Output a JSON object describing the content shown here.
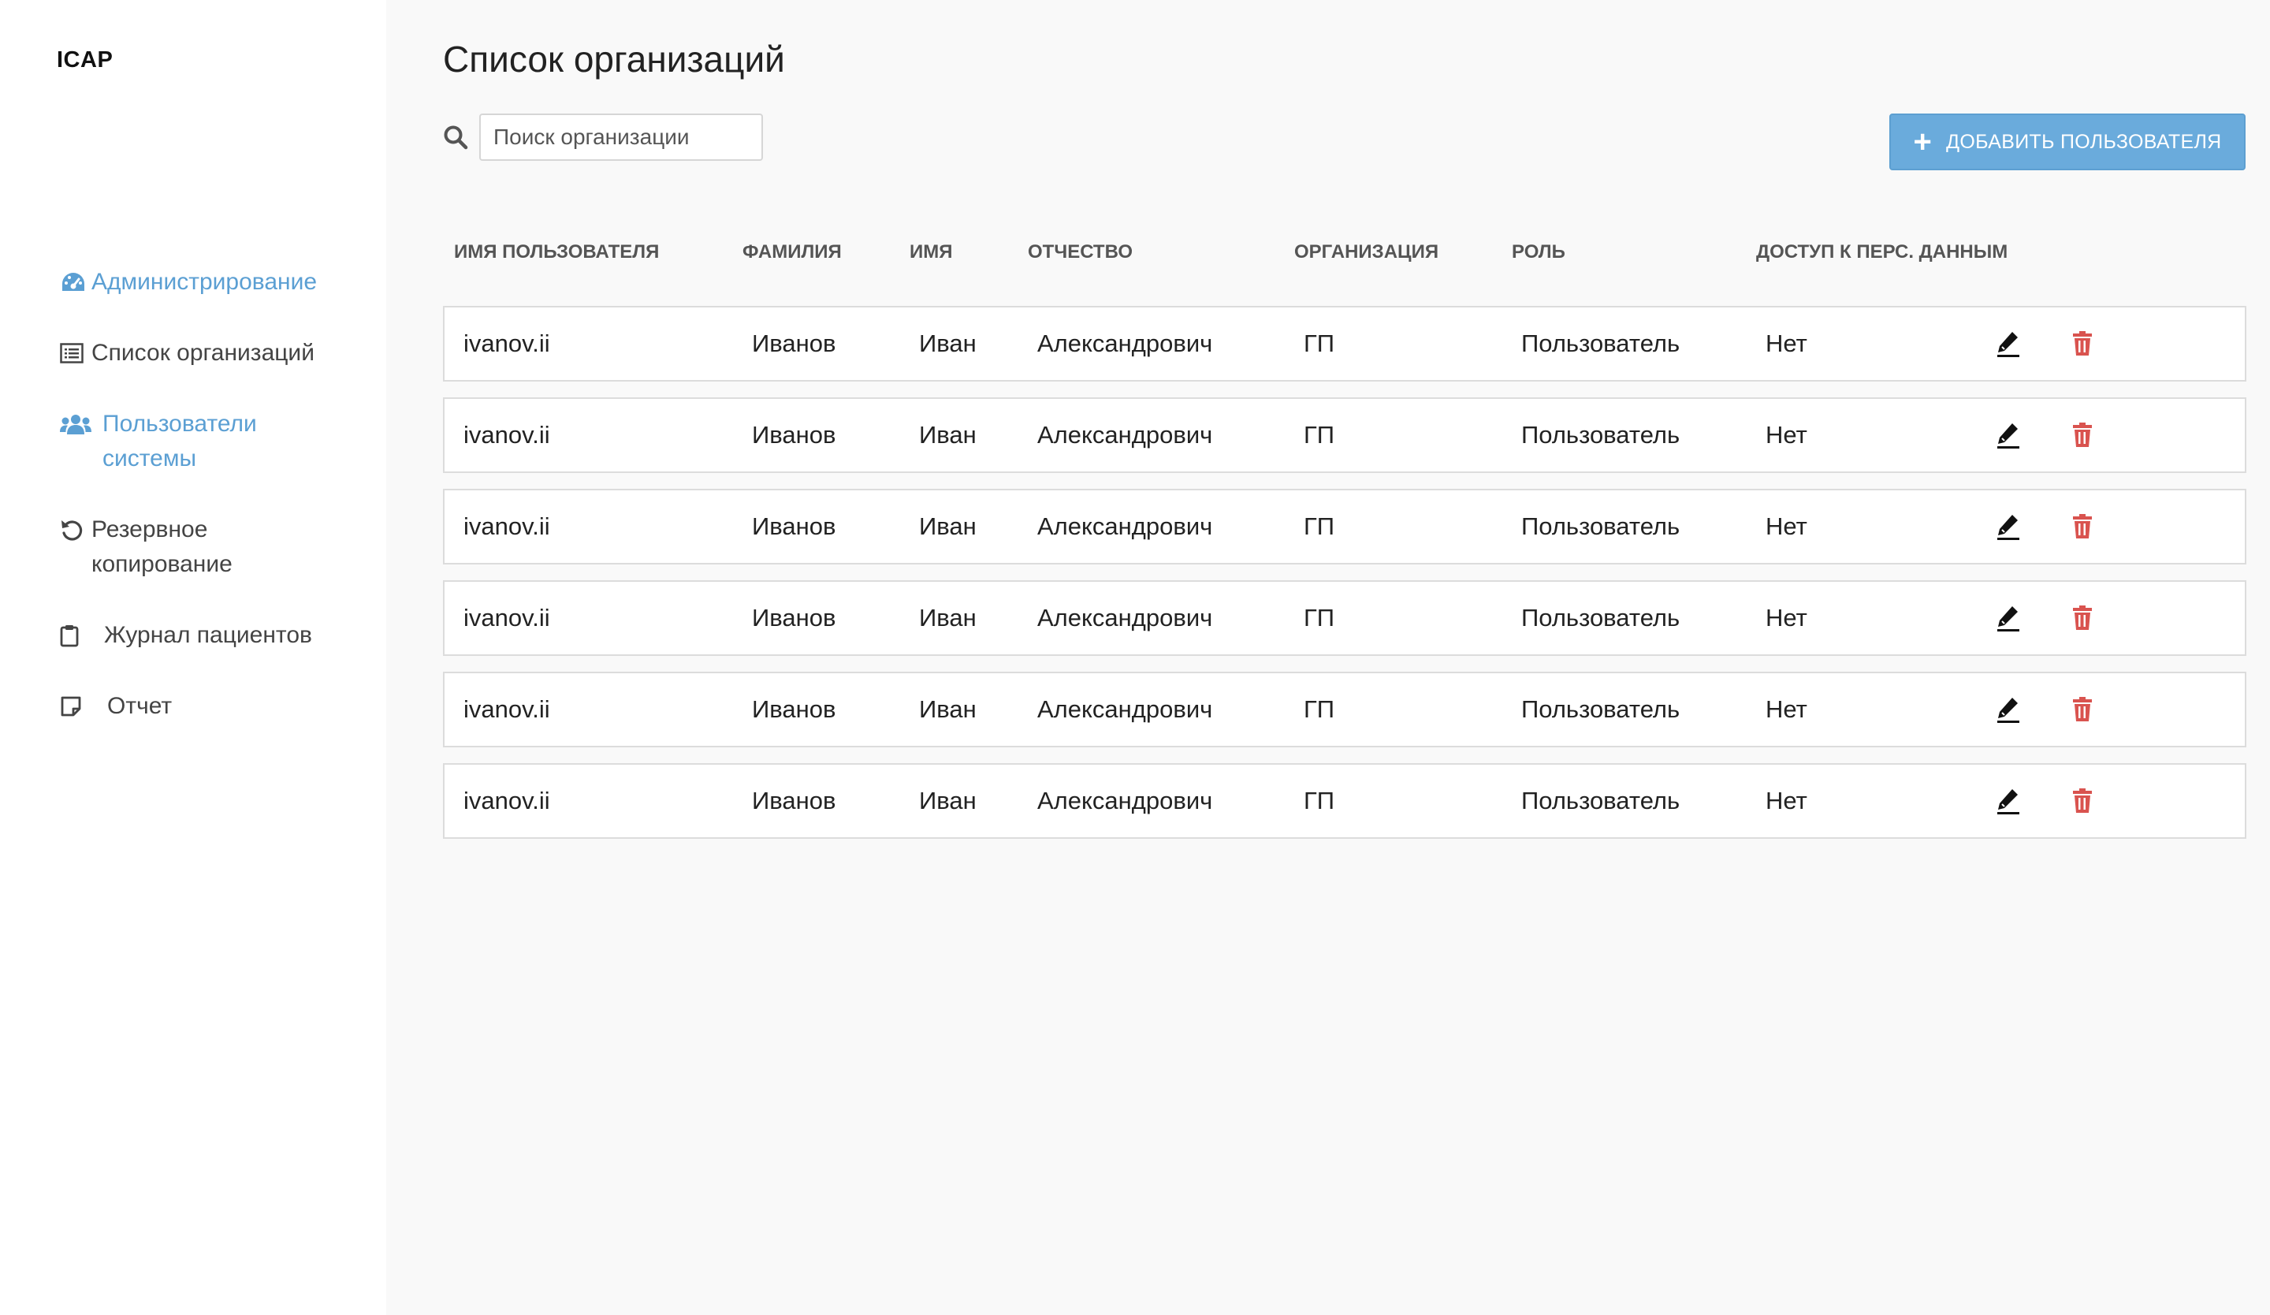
{
  "app": {
    "logo": "ICAP"
  },
  "sidebar": {
    "items": [
      {
        "label": "Администрирование",
        "icon": "dashboard-icon",
        "active": true
      },
      {
        "label": "Список организаций",
        "icon": "list-icon",
        "active": false
      },
      {
        "label": "Пользователи системы",
        "icon": "users-icon",
        "active": true
      },
      {
        "label": "Резервное копирование",
        "icon": "undo-icon",
        "active": false
      },
      {
        "label": "Журнал пациентов",
        "icon": "clipboard-icon",
        "active": false
      },
      {
        "label": "Отчет",
        "icon": "note-icon",
        "active": false
      }
    ]
  },
  "main": {
    "title": "Список организаций",
    "search": {
      "placeholder": "Поиск организации",
      "value": ""
    },
    "add_button": {
      "label": "ДОБАВИТЬ ПОЛЬЗОВАТЕЛЯ",
      "icon": "plus-icon"
    },
    "table": {
      "columns": [
        "Имя пользователя",
        "Фамилия",
        "Имя",
        "Отчество",
        "Организация",
        "Роль",
        "Доступ к перс. данным"
      ],
      "rows": [
        [
          "ivanov.ii",
          "Иванов",
          "Иван",
          "Александрович",
          "ГП",
          "Пользователь",
          "Нет"
        ],
        [
          "ivanov.ii",
          "Иванов",
          "Иван",
          "Александрович",
          "ГП",
          "Пользователь",
          "Нет"
        ],
        [
          "ivanov.ii",
          "Иванов",
          "Иван",
          "Александрович",
          "ГП",
          "Пользователь",
          "Нет"
        ],
        [
          "ivanov.ii",
          "Иванов",
          "Иван",
          "Александрович",
          "ГП",
          "Пользователь",
          "Нет"
        ],
        [
          "ivanov.ii",
          "Иванов",
          "Иван",
          "Александрович",
          "ГП",
          "Пользователь",
          "Нет"
        ],
        [
          "ivanov.ii",
          "Иванов",
          "Иван",
          "Александрович",
          "ГП",
          "Пользователь",
          "Нет"
        ]
      ],
      "row_actions": {
        "edit_icon": "pencil-icon",
        "delete_icon": "trash-icon"
      }
    }
  },
  "colors": {
    "accent": "#5b9fd3",
    "button": "#6aabdc",
    "delete": "#d9534f",
    "sidebar_bg": "#ffffff",
    "main_bg": "#f9f9f9"
  }
}
